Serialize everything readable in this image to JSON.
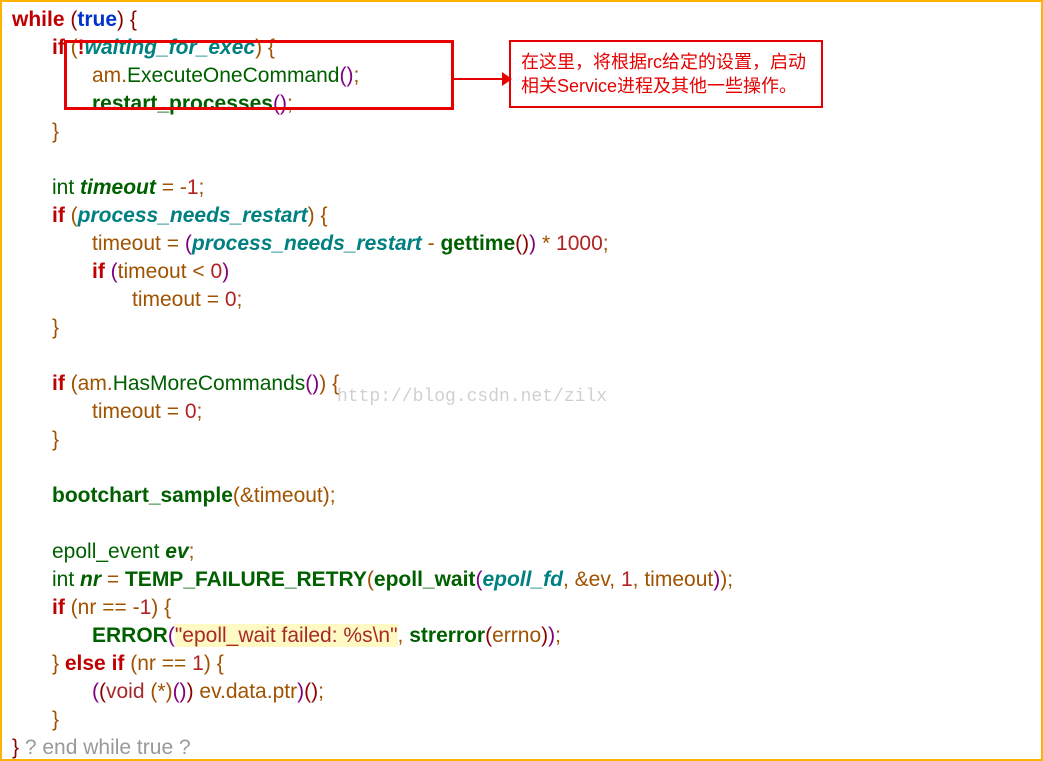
{
  "code": {
    "kw_while": "while",
    "kw_true": "true",
    "kw_if": "if",
    "kw_else_if": "else if",
    "op_not": "!",
    "id_waiting": "waiting_for_exec",
    "obj_am": "am",
    "fn_exec_one": "ExecuteOneCommand",
    "fn_restart_proc": "restart_processes",
    "type_int": "int",
    "id_timeout": "timeout",
    "neg1": "1",
    "id_proc_needs": "process_needs_restart",
    "fn_gettime": "gettime",
    "num_1000": "1000",
    "num_0": "0",
    "fn_has_more": "HasMoreCommands",
    "fn_bootchart": "bootchart_sample",
    "type_epoll_event": "epoll_event",
    "id_ev": "ev",
    "id_nr": "nr",
    "fn_temp_fail": "TEMP_FAILURE_RETRY",
    "fn_epoll_wait": "epoll_wait",
    "id_epoll_fd": "epoll_fd",
    "num_1": "1",
    "fn_error": "ERROR",
    "str_err": "\"epoll_wait failed: %s\\n\"",
    "fn_strerror": "strerror",
    "id_errno": "errno",
    "id_evdata": "ev.data.ptr",
    "type_void": "void",
    "comment_end": "?  end while true ?"
  },
  "annotation": "在这里，将根据rc给定的设置，启动相关Service进程及其他一些操作。",
  "watermark": "http://blog.csdn.net/zilx"
}
